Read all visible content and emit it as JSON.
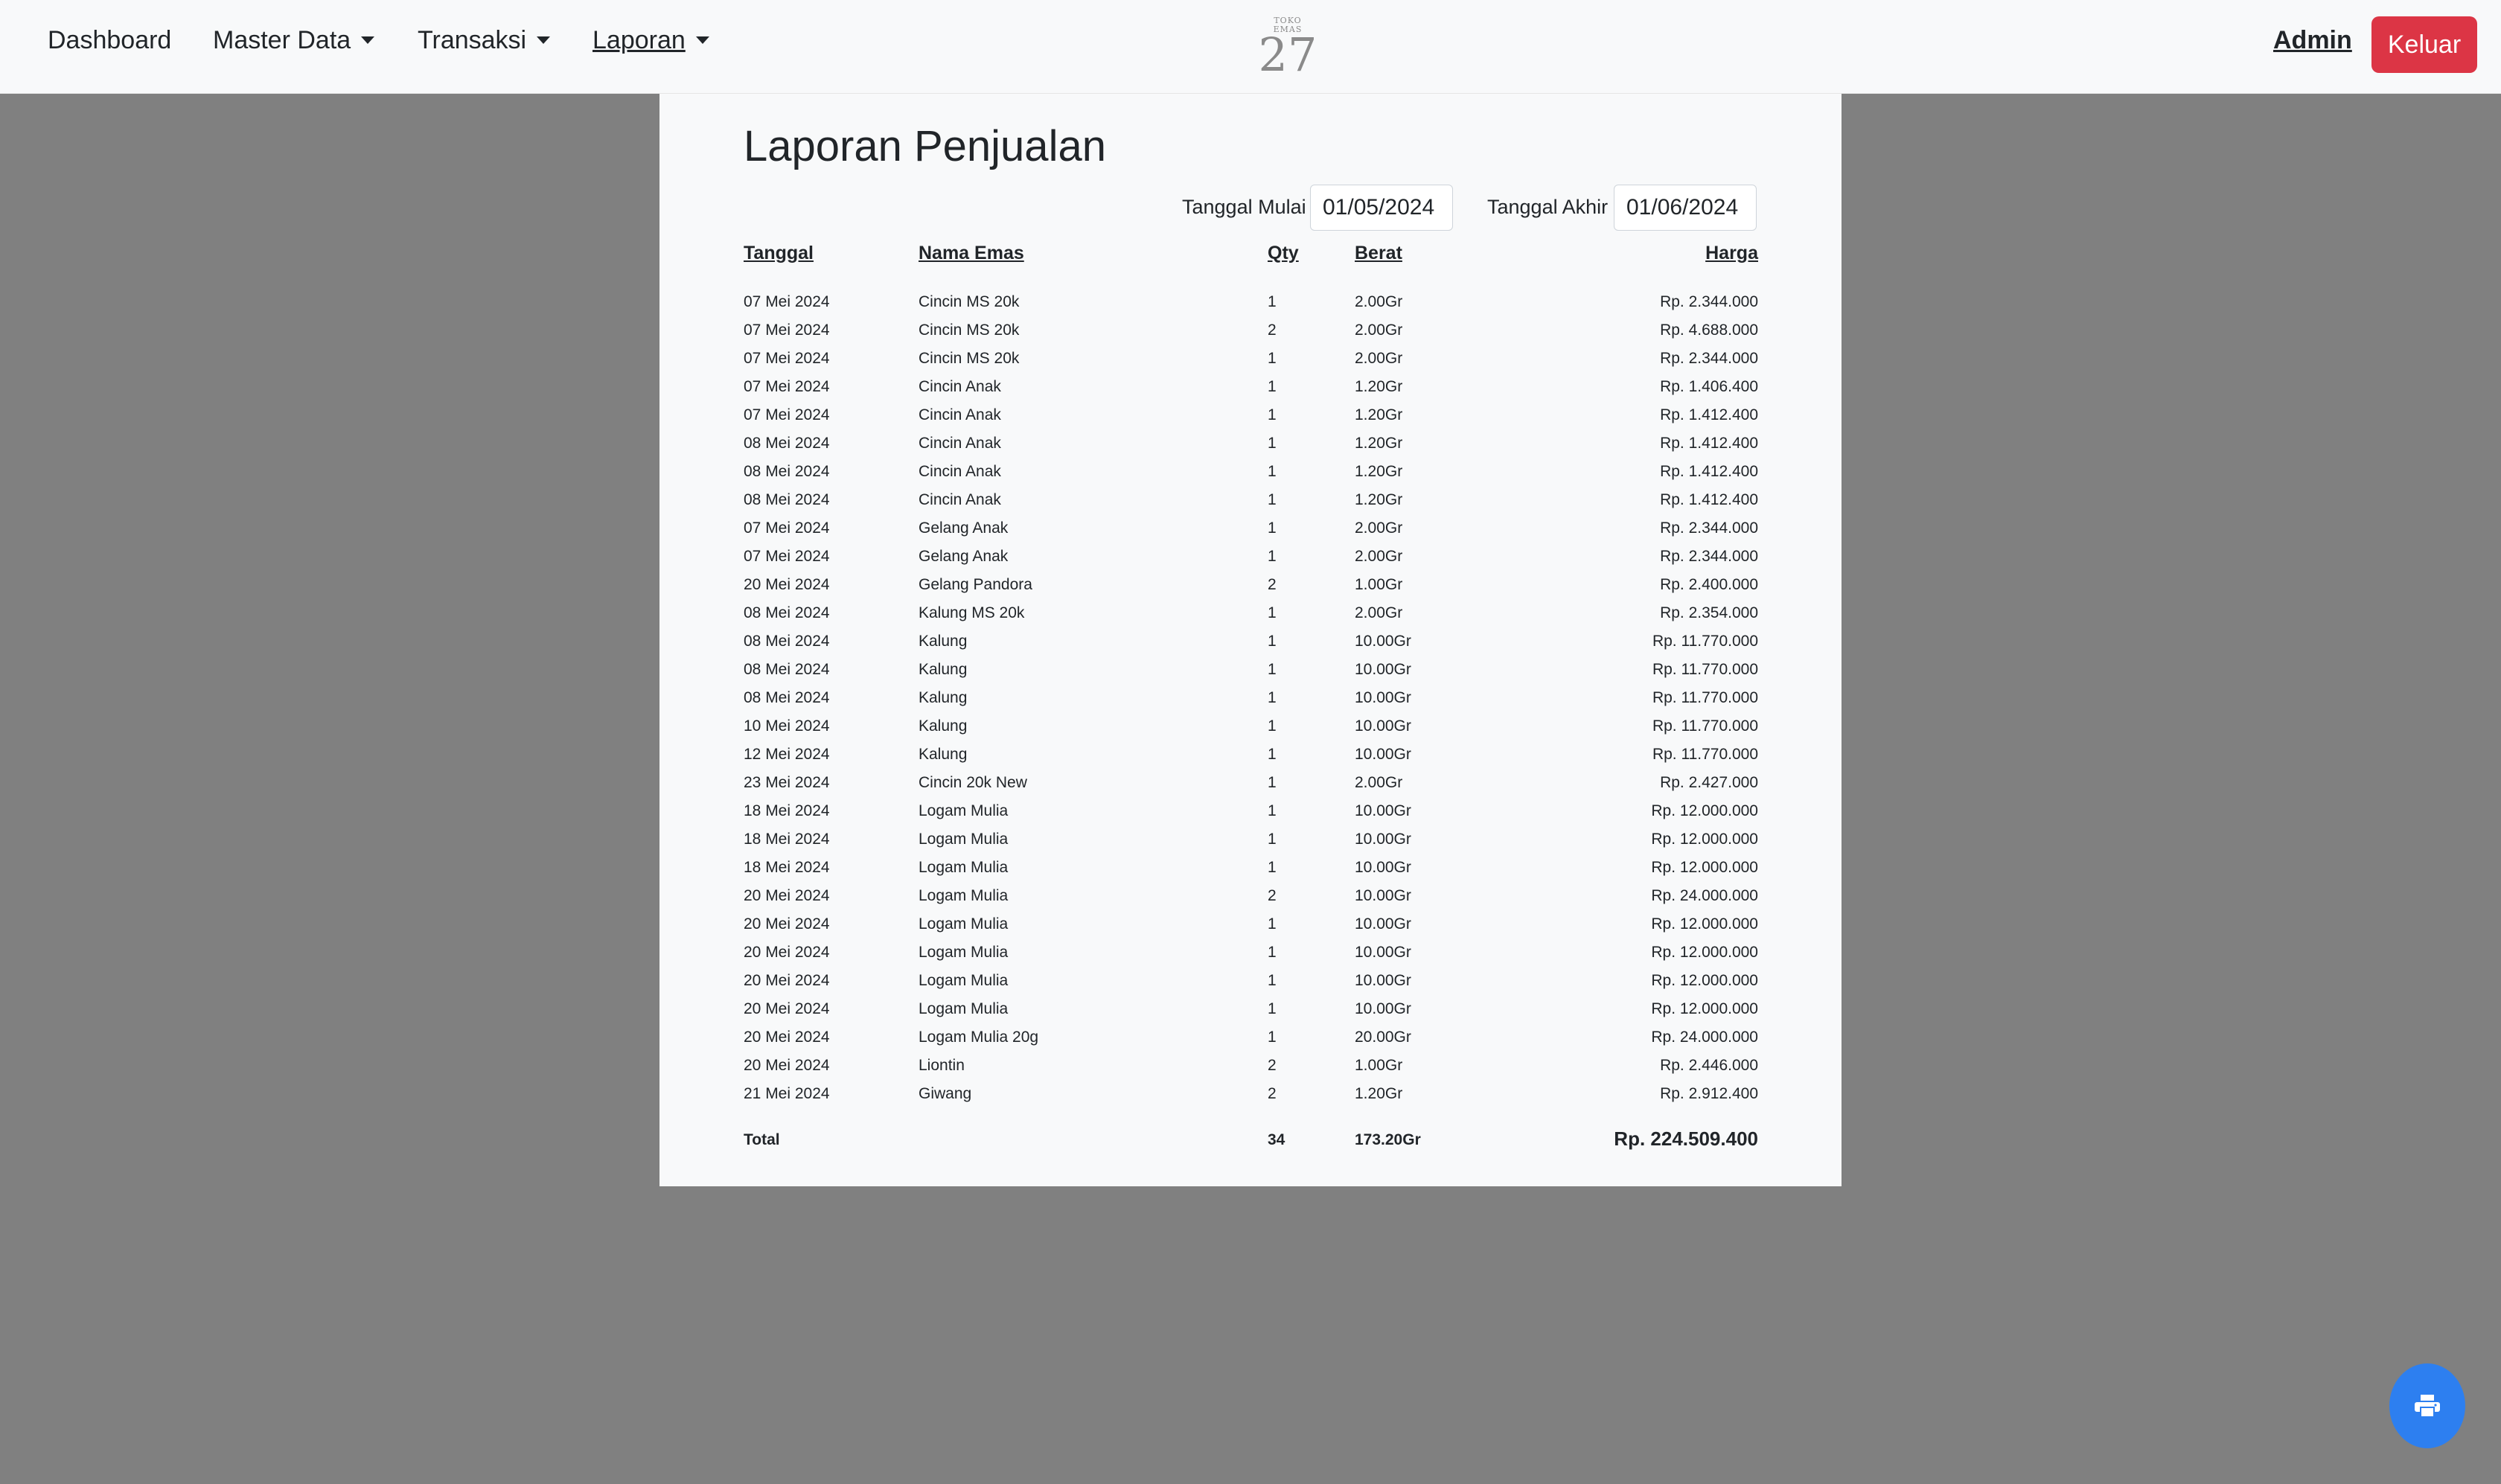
{
  "nav": {
    "dashboard": "Dashboard",
    "master_data": "Master Data",
    "transaksi": "Transaksi",
    "laporan": "Laporan",
    "logo_small": "TOKO EMAS",
    "logo_number": "27",
    "admin": "Admin",
    "logout": "Keluar"
  },
  "report": {
    "title": "Laporan Penjualan",
    "start_label": "Tanggal Mulai",
    "start_value": "01/05/2024",
    "end_label": "Tanggal Akhir",
    "end_value": "01/06/2024",
    "headers": {
      "date": "Tanggal",
      "name": "Nama Emas",
      "qty": "Qty",
      "weight": "Berat",
      "price": "Harga"
    },
    "rows": [
      {
        "date": "07 Mei 2024",
        "name": "Cincin MS 20k",
        "qty": "1",
        "weight": "2.00Gr",
        "price": "Rp. 2.344.000"
      },
      {
        "date": "07 Mei 2024",
        "name": "Cincin MS 20k",
        "qty": "2",
        "weight": "2.00Gr",
        "price": "Rp. 4.688.000"
      },
      {
        "date": "07 Mei 2024",
        "name": "Cincin MS 20k",
        "qty": "1",
        "weight": "2.00Gr",
        "price": "Rp. 2.344.000"
      },
      {
        "date": "07 Mei 2024",
        "name": "Cincin Anak",
        "qty": "1",
        "weight": "1.20Gr",
        "price": "Rp. 1.406.400"
      },
      {
        "date": "07 Mei 2024",
        "name": "Cincin Anak",
        "qty": "1",
        "weight": "1.20Gr",
        "price": "Rp. 1.412.400"
      },
      {
        "date": "08 Mei 2024",
        "name": "Cincin Anak",
        "qty": "1",
        "weight": "1.20Gr",
        "price": "Rp. 1.412.400"
      },
      {
        "date": "08 Mei 2024",
        "name": "Cincin Anak",
        "qty": "1",
        "weight": "1.20Gr",
        "price": "Rp. 1.412.400"
      },
      {
        "date": "08 Mei 2024",
        "name": "Cincin Anak",
        "qty": "1",
        "weight": "1.20Gr",
        "price": "Rp. 1.412.400"
      },
      {
        "date": "07 Mei 2024",
        "name": "Gelang Anak",
        "qty": "1",
        "weight": "2.00Gr",
        "price": "Rp. 2.344.000"
      },
      {
        "date": "07 Mei 2024",
        "name": "Gelang Anak",
        "qty": "1",
        "weight": "2.00Gr",
        "price": "Rp. 2.344.000"
      },
      {
        "date": "20 Mei 2024",
        "name": "Gelang Pandora",
        "qty": "2",
        "weight": "1.00Gr",
        "price": "Rp. 2.400.000"
      },
      {
        "date": "08 Mei 2024",
        "name": "Kalung MS 20k",
        "qty": "1",
        "weight": "2.00Gr",
        "price": "Rp. 2.354.000"
      },
      {
        "date": "08 Mei 2024",
        "name": "Kalung",
        "qty": "1",
        "weight": "10.00Gr",
        "price": "Rp. 11.770.000"
      },
      {
        "date": "08 Mei 2024",
        "name": "Kalung",
        "qty": "1",
        "weight": "10.00Gr",
        "price": "Rp. 11.770.000"
      },
      {
        "date": "08 Mei 2024",
        "name": "Kalung",
        "qty": "1",
        "weight": "10.00Gr",
        "price": "Rp. 11.770.000"
      },
      {
        "date": "10 Mei 2024",
        "name": "Kalung",
        "qty": "1",
        "weight": "10.00Gr",
        "price": "Rp. 11.770.000"
      },
      {
        "date": "12 Mei 2024",
        "name": "Kalung",
        "qty": "1",
        "weight": "10.00Gr",
        "price": "Rp. 11.770.000"
      },
      {
        "date": "23 Mei 2024",
        "name": "Cincin 20k New",
        "qty": "1",
        "weight": "2.00Gr",
        "price": "Rp. 2.427.000"
      },
      {
        "date": "18 Mei 2024",
        "name": "Logam Mulia",
        "qty": "1",
        "weight": "10.00Gr",
        "price": "Rp. 12.000.000"
      },
      {
        "date": "18 Mei 2024",
        "name": "Logam Mulia",
        "qty": "1",
        "weight": "10.00Gr",
        "price": "Rp. 12.000.000"
      },
      {
        "date": "18 Mei 2024",
        "name": "Logam Mulia",
        "qty": "1",
        "weight": "10.00Gr",
        "price": "Rp. 12.000.000"
      },
      {
        "date": "20 Mei 2024",
        "name": "Logam Mulia",
        "qty": "2",
        "weight": "10.00Gr",
        "price": "Rp. 24.000.000"
      },
      {
        "date": "20 Mei 2024",
        "name": "Logam Mulia",
        "qty": "1",
        "weight": "10.00Gr",
        "price": "Rp. 12.000.000"
      },
      {
        "date": "20 Mei 2024",
        "name": "Logam Mulia",
        "qty": "1",
        "weight": "10.00Gr",
        "price": "Rp. 12.000.000"
      },
      {
        "date": "20 Mei 2024",
        "name": "Logam Mulia",
        "qty": "1",
        "weight": "10.00Gr",
        "price": "Rp. 12.000.000"
      },
      {
        "date": "20 Mei 2024",
        "name": "Logam Mulia",
        "qty": "1",
        "weight": "10.00Gr",
        "price": "Rp. 12.000.000"
      },
      {
        "date": "20 Mei 2024",
        "name": "Logam Mulia 20g",
        "qty": "1",
        "weight": "20.00Gr",
        "price": "Rp. 24.000.000"
      },
      {
        "date": "20 Mei 2024",
        "name": "Liontin",
        "qty": "2",
        "weight": "1.00Gr",
        "price": "Rp. 2.446.000"
      },
      {
        "date": "21 Mei 2024",
        "name": "Giwang",
        "qty": "2",
        "weight": "1.20Gr",
        "price": "Rp. 2.912.400"
      }
    ],
    "total": {
      "label": "Total",
      "qty": "34",
      "weight": "173.20Gr",
      "price": "Rp. 224.509.400"
    }
  },
  "print_button": {
    "icon": "printer-icon"
  },
  "colors": {
    "backdrop": "#808080",
    "sheet": "#f8f9fa",
    "logout": "#dc3545",
    "fab": "#2d7ff0"
  }
}
